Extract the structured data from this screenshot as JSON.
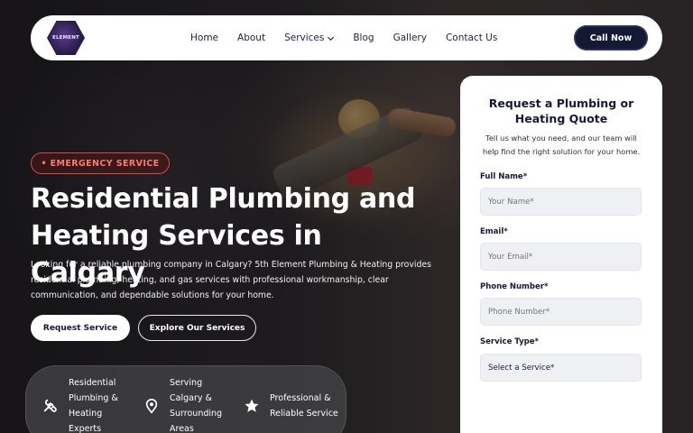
{
  "header": {
    "logo_text": "ELEMENT",
    "nav": [
      {
        "label": "Home"
      },
      {
        "label": "About"
      },
      {
        "label": "Services",
        "has_dropdown": true
      },
      {
        "label": "Blog"
      },
      {
        "label": "Gallery"
      },
      {
        "label": "Contact Us"
      }
    ],
    "call_button": "Call Now"
  },
  "hero": {
    "badge": "• EMERGENCY SERVICE",
    "headline_line1": "Residential Plumbing and",
    "headline_line2": "Heating Services in Calgary",
    "lede": "Looking for a reliable plumbing company in Calgary? 5th Element Plumbing & Heating provides residential plumbing, heating, and gas services with professional workmanship, clear communication, and dependable solutions for your home.",
    "primary_button": "Request Service",
    "secondary_button": "Explore Our Services",
    "features": [
      {
        "icon": "tools-icon",
        "lines": [
          "Residential",
          "Plumbing &",
          "Heating",
          "Experts"
        ]
      },
      {
        "icon": "location-pin-icon",
        "lines": [
          "Serving",
          "Calgary &",
          "Surrounding",
          "Areas"
        ]
      },
      {
        "icon": "star-icon",
        "lines": [
          "Professional &",
          "Reliable Service"
        ]
      }
    ]
  },
  "quote_form": {
    "title": "Request a Plumbing or Heating Quote",
    "subtitle": "Tell us what you need, and our team will help find the right solution for your home.",
    "fields": {
      "name": {
        "label": "Full Name*",
        "placeholder": "Your Name*"
      },
      "email": {
        "label": "Email*",
        "placeholder": "Your Email*"
      },
      "phone": {
        "label": "Phone Number*",
        "placeholder": "Phone Number*"
      },
      "service": {
        "label": "Service Type*",
        "selected": "Select a Service*"
      }
    }
  },
  "colors": {
    "navy": "#141a33",
    "emergency_red": "#d64a4a",
    "white": "#ffffff"
  }
}
